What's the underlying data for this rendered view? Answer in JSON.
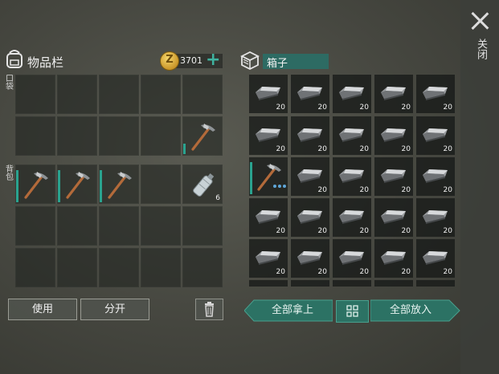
{
  "close": {
    "label": "关闭"
  },
  "inventory": {
    "title": "物品栏",
    "coins": "3701",
    "add": "+",
    "pocket_label": "口袋",
    "backpack_label": "背包",
    "use_button": "使用",
    "split_button": "分开",
    "pocket_slots": [
      {
        "item": null
      },
      {
        "item": null
      },
      {
        "item": null
      },
      {
        "item": null
      },
      {
        "item": null
      },
      {
        "item": null
      },
      {
        "item": null
      },
      {
        "item": null
      },
      {
        "item": null
      },
      {
        "item": "pickaxe",
        "durability": 0.2
      }
    ],
    "backpack_slots": [
      {
        "item": "pickaxe",
        "durability": 0.9
      },
      {
        "item": "pickaxe",
        "durability": 0.9
      },
      {
        "item": "pickaxe",
        "durability": 0.9
      },
      {
        "item": null
      },
      {
        "item": "water-bottle",
        "qty": "6"
      },
      {
        "item": null
      },
      {
        "item": null
      },
      {
        "item": null
      },
      {
        "item": null
      },
      {
        "item": null
      },
      {
        "item": null
      },
      {
        "item": null
      },
      {
        "item": null
      },
      {
        "item": null
      },
      {
        "item": null
      }
    ]
  },
  "box": {
    "title": "箱子",
    "take_all_button": "全部拿上",
    "put_all_button": "全部放入",
    "rows": [
      [
        "20",
        "20",
        "20",
        "20",
        "20"
      ],
      [
        "20",
        "20",
        "20",
        "20",
        "20"
      ],
      [
        "pickaxe",
        "20",
        "20",
        "20",
        "20"
      ],
      [
        "20",
        "20",
        "20",
        "20",
        "20"
      ],
      [
        "20",
        "20",
        "20",
        "20",
        "20"
      ]
    ]
  },
  "colors": {
    "accent": "#2c7264",
    "plus": "#3fb29f",
    "durability": "#2aa38f"
  }
}
